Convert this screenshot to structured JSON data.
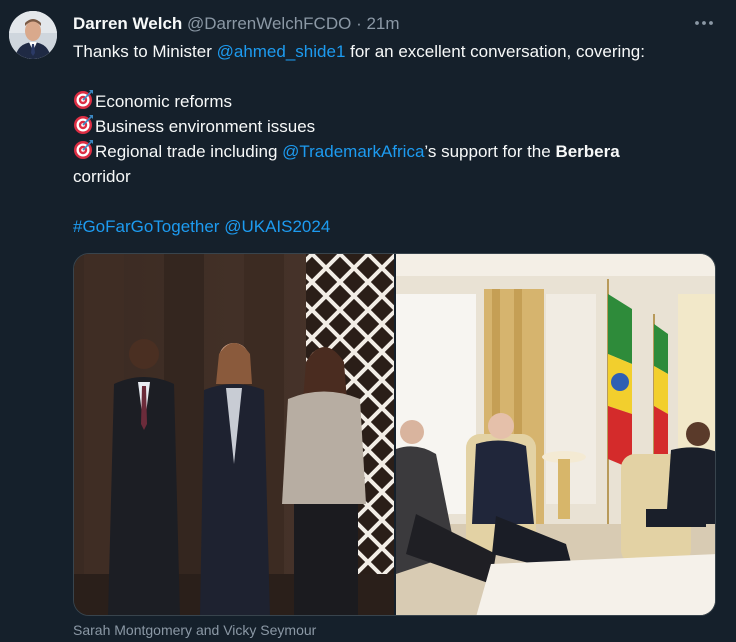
{
  "author": {
    "name": "Darren Welch",
    "handle": "@DarrenWelchFCDO",
    "separator": "·",
    "time": "21m"
  },
  "tweet": {
    "intro_prefix": "Thanks to Minister ",
    "intro_mention": "@ahmed_shide1",
    "intro_suffix": " for an excellent conversation, covering:",
    "bullet_icon": "direct-hit-emoji",
    "bullets": {
      "one": "Economic reforms",
      "two": "Business environment issues",
      "three_prefix": "Regional trade including ",
      "three_mention": "@TrademarkAfrica",
      "three_middle": "’s support for the ",
      "three_bold": "Berbera",
      "three_line2": "corridor"
    },
    "hashtag": "#GoFarGoTogether",
    "tag": "@UKAIS2024"
  },
  "media": {
    "caption": "Sarah Montgomery and Vicky Seymour"
  },
  "colors": {
    "background": "#15202b",
    "text": "#f7f9f9",
    "secondary": "#8b98a5",
    "link": "#1d9bf0"
  }
}
